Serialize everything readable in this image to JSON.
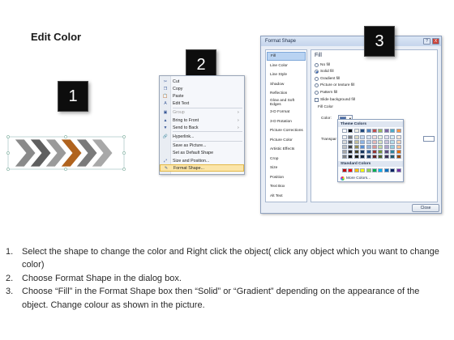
{
  "title": "Edit Color",
  "badges": {
    "one": "1",
    "two": "2",
    "three": "3"
  },
  "chevrons": {
    "colors": [
      "#8a8a8a",
      "#5f5f5f",
      "#9a9a9a",
      "#b0631e",
      "#7a7a7a",
      "#a8a8a8"
    ]
  },
  "context_menu": {
    "items": [
      {
        "label": "Cut",
        "icon": "scissors-icon",
        "disabled": false
      },
      {
        "label": "Copy",
        "icon": "copy-icon",
        "disabled": false
      },
      {
        "label": "Paste",
        "icon": "paste-icon",
        "disabled": false
      },
      {
        "label": "Edit Text",
        "icon": "edit-text-icon",
        "disabled": false
      },
      {
        "label": "Group",
        "icon": "group-icon",
        "disabled": true,
        "submenu": true
      },
      {
        "label": "Bring to Front",
        "icon": "bring-front-icon",
        "disabled": false,
        "submenu": true
      },
      {
        "label": "Send to Back",
        "icon": "send-back-icon",
        "disabled": false,
        "submenu": true
      },
      {
        "label": "Hyperlink...",
        "icon": "hyperlink-icon",
        "disabled": false
      },
      {
        "label": "Save as Picture...",
        "icon": "",
        "disabled": false
      },
      {
        "label": "Set as Default Shape",
        "icon": "",
        "disabled": false
      },
      {
        "label": "Size and Position...",
        "icon": "size-icon",
        "disabled": false
      },
      {
        "label": "Format Shape...",
        "icon": "format-shape-icon",
        "disabled": false,
        "highlighted": true
      }
    ]
  },
  "dialog": {
    "title": "Format Shape",
    "help": "?",
    "close_x": "X",
    "nav": [
      "Fill",
      "Line Color",
      "Line Style",
      "Shadow",
      "Reflection",
      "Glow and Soft Edges",
      "3-D Format",
      "3-D Rotation",
      "Picture Corrections",
      "Picture Color",
      "Artistic Effects",
      "Crop",
      "Size",
      "Position",
      "Text Box",
      "Alt Text"
    ],
    "fill_heading": "Fill",
    "options": [
      "No fill",
      "Solid fill",
      "Gradient fill",
      "Picture or texture fill",
      "Pattern fill",
      "Slide background fill"
    ],
    "selected_option": 1,
    "fill_color_label": "Fill Color",
    "color_label": "Color:",
    "transparency_label": "Transpar",
    "close_button": "Close"
  },
  "palette": {
    "theme_heading": "Theme Colors",
    "standard_heading": "Standard Colors",
    "more_colors": "More Colors...",
    "theme_top": [
      "#ffffff",
      "#000000",
      "#eeece1",
      "#1f497d",
      "#4f81bd",
      "#c0504d",
      "#9bbb59",
      "#8064a2",
      "#4bacc6",
      "#f79646"
    ],
    "theme_columns": [
      [
        "#f2f2f2",
        "#d9d9d9",
        "#bfbfbf",
        "#a6a6a6",
        "#808080"
      ],
      [
        "#7f7f7f",
        "#595959",
        "#404040",
        "#262626",
        "#0d0d0d"
      ],
      [
        "#ddd9c3",
        "#c4bd97",
        "#948a54",
        "#4a452a",
        "#1d1b10"
      ],
      [
        "#c6d9f0",
        "#8db3e2",
        "#548dd4",
        "#17365d",
        "#0f243e"
      ],
      [
        "#dbe5f1",
        "#b8cce4",
        "#95b3d7",
        "#366092",
        "#244061"
      ],
      [
        "#f2dcdb",
        "#e5b9b7",
        "#d99694",
        "#953734",
        "#632423"
      ],
      [
        "#ebf1dd",
        "#d7e3bc",
        "#c3d69b",
        "#76923c",
        "#4f6128"
      ],
      [
        "#e5e0ec",
        "#ccc1d9",
        "#b2a2c7",
        "#5f497a",
        "#3f3151"
      ],
      [
        "#dbeef3",
        "#b7dde8",
        "#92cddc",
        "#31859b",
        "#205867"
      ],
      [
        "#fdeada",
        "#fbd5b5",
        "#fac08f",
        "#e36c09",
        "#974806"
      ]
    ],
    "standard": [
      "#c00000",
      "#ff0000",
      "#ffc000",
      "#ffff00",
      "#92d050",
      "#00b050",
      "#00b0f0",
      "#0070c0",
      "#002060",
      "#7030a0"
    ]
  },
  "instructions": [
    {
      "num": "1.",
      "text": "Select the shape to change the color and Right click the object( click any object which you want to change color)"
    },
    {
      "num": "2.",
      "text": "Choose Format Shape in the dialog box."
    },
    {
      "num": "3.",
      "text": "Choose “Fill” in the Format Shape box then “Solid” or “Gradient” depending on the appearance of the object. Change colour as shown in the picture."
    }
  ]
}
